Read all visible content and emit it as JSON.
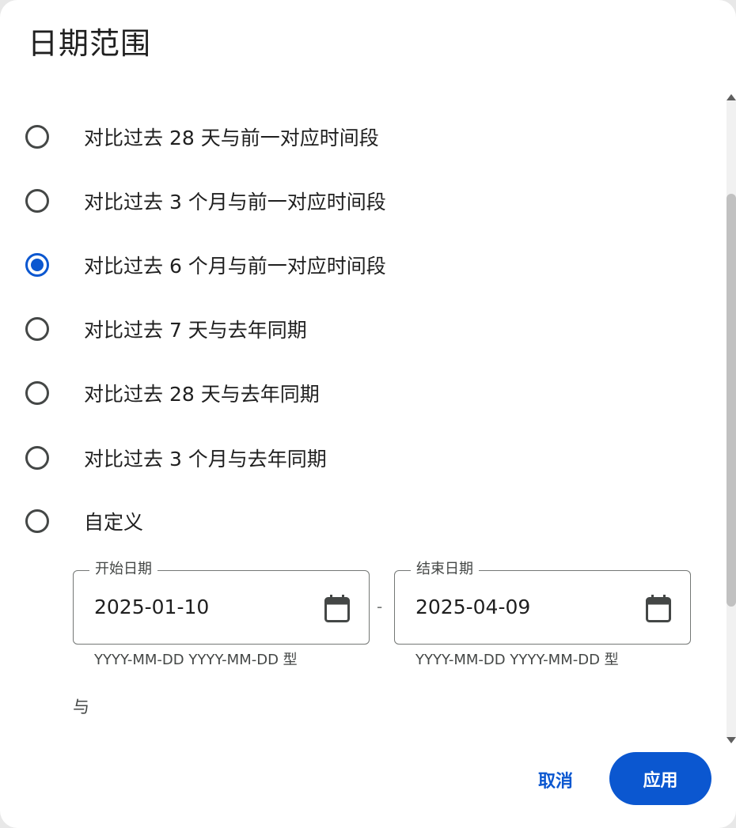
{
  "dialog": {
    "title": "日期范围",
    "options": [
      {
        "label": "对比过去 28 天与前一对应时间段",
        "selected": false
      },
      {
        "label": "对比过去 3 个月与前一对应时间段",
        "selected": false
      },
      {
        "label": "对比过去 6 个月与前一对应时间段",
        "selected": true
      },
      {
        "label": "对比过去 7 天与去年同期",
        "selected": false
      },
      {
        "label": "对比过去 28 天与去年同期",
        "selected": false
      },
      {
        "label": "对比过去 3 个月与去年同期",
        "selected": false
      },
      {
        "label": "自定义",
        "selected": false
      }
    ],
    "start_date": {
      "label": "开始日期",
      "value": "2025-01-10",
      "hint": "YYYY-MM-DD  YYYY-MM-DD 型"
    },
    "separator": "-",
    "end_date": {
      "label": "结束日期",
      "value": "2025-04-09",
      "hint": "YYYY-MM-DD  YYYY-MM-DD 型"
    },
    "joiner_text": "与",
    "buttons": {
      "cancel": "取消",
      "apply": "应用"
    }
  },
  "colors": {
    "accent": "#0b57d0",
    "text": "#1f1f1f",
    "secondary_text": "#444746",
    "outline": "#747775"
  },
  "icons": {
    "date_picker": "calendar-icon",
    "radio": "radio-button"
  }
}
